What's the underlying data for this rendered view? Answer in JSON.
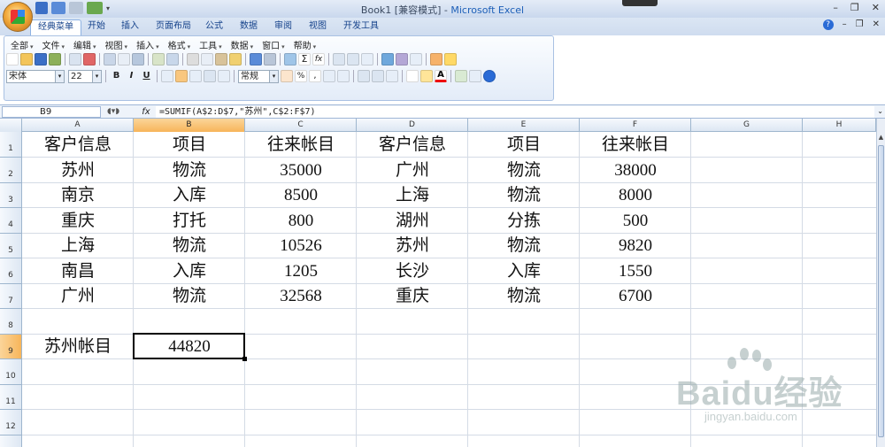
{
  "window": {
    "title_doc": "Book1",
    "title_mode": "[兼容模式]",
    "title_app": "Microsoft Excel"
  },
  "ribbon_tabs": [
    "经典菜单",
    "开始",
    "插入",
    "页面布局",
    "公式",
    "数据",
    "审阅",
    "视图",
    "开发工具"
  ],
  "active_tab": "经典菜单",
  "classic_menu": [
    "全部",
    "文件",
    "编辑",
    "视图",
    "插入",
    "格式",
    "工具",
    "数据",
    "窗口",
    "帮助"
  ],
  "font": {
    "name": "宋体",
    "size": "22",
    "number_format": "常规"
  },
  "format_buttons": {
    "bold": "B",
    "italic": "I",
    "underline": "U"
  },
  "formula_bar": {
    "name_box": "B9",
    "fx": "fx",
    "formula": "=SUMIF(A$2:D$7,\"苏州\",C$2:F$7)"
  },
  "columns": [
    "A",
    "B",
    "C",
    "D",
    "E",
    "F",
    "G",
    "H"
  ],
  "selected_column": "B",
  "rows": [
    "1",
    "2",
    "3",
    "4",
    "5",
    "6",
    "7",
    "8",
    "9",
    "10",
    "11",
    "12"
  ],
  "selected_row": "9",
  "cells": {
    "r1": [
      "客户信息",
      "项目",
      "往来帐目",
      "客户信息",
      "项目",
      "往来帐目"
    ],
    "r2": [
      "苏州",
      "物流",
      "35000",
      "广州",
      "物流",
      "38000"
    ],
    "r3": [
      "南京",
      "入库",
      "8500",
      "上海",
      "物流",
      "8000"
    ],
    "r4": [
      "重庆",
      "打托",
      "800",
      "湖州",
      "分拣",
      "500"
    ],
    "r5": [
      "上海",
      "物流",
      "10526",
      "苏州",
      "物流",
      "9820"
    ],
    "r6": [
      "南昌",
      "入库",
      "1205",
      "长沙",
      "入库",
      "1550"
    ],
    "r7": [
      "广州",
      "物流",
      "32568",
      "重庆",
      "物流",
      "6700"
    ],
    "r9": [
      "苏州帐目",
      "44820"
    ]
  },
  "watermark": {
    "brand": "Baidu经验",
    "url": "jingyan.baidu.com"
  },
  "colors": {
    "accent": "#1d5fb8",
    "selected_header": "#f7b55a",
    "grid": "#d4dbe5"
  }
}
